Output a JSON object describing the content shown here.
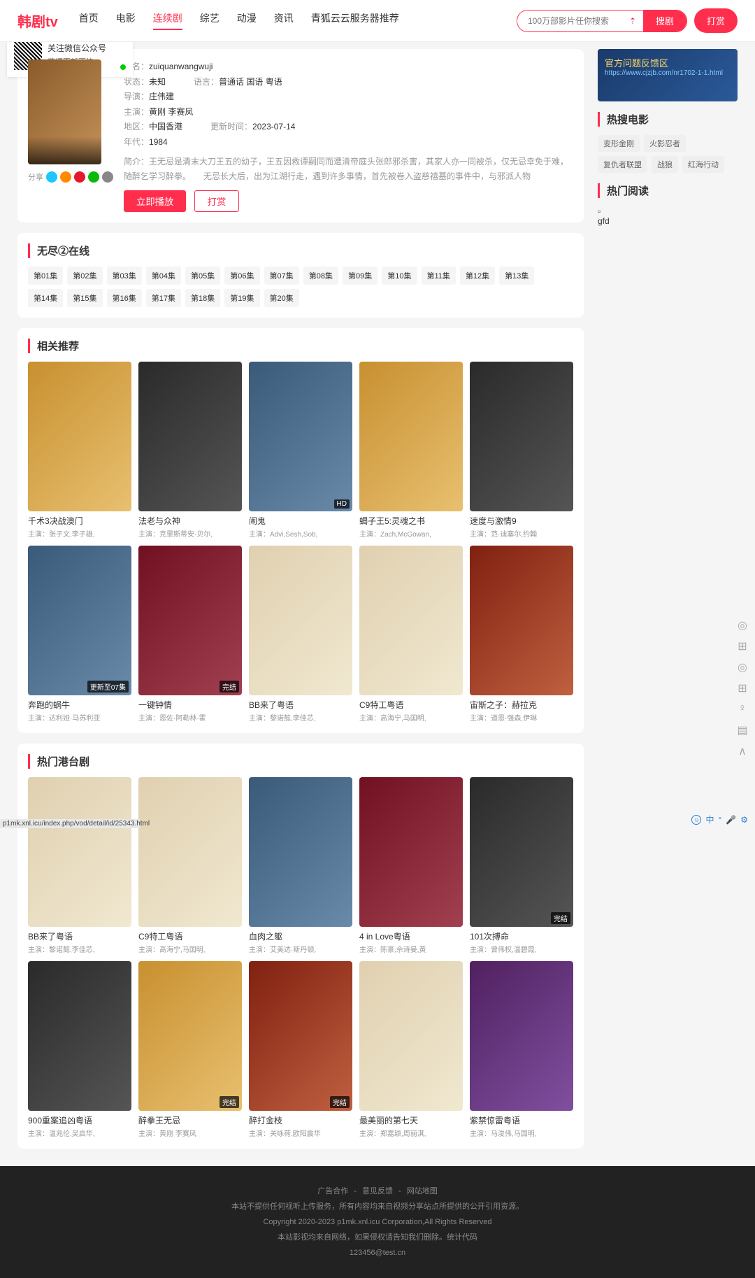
{
  "logo": "韩剧tv",
  "nav": [
    "首页",
    "电影",
    "连续剧",
    "综艺",
    "动漫",
    "资讯",
    "青狐云云服务器推荐"
  ],
  "nav_active": 2,
  "search": {
    "placeholder": "100万部影片任你搜索",
    "btn": "搜剧"
  },
  "reward": "打赏",
  "wechat": {
    "title": "关注微信公众号",
    "sub": "获得更新更快"
  },
  "detail": {
    "alias_lbl": "别名：",
    "alias": "zuiquanwangwuji",
    "status_lbl": "状态：",
    "status": "未知",
    "lang_lbl": "语言：",
    "lang": "普通话 国语 粤语",
    "director_lbl": "导演：",
    "director": "庄伟建",
    "cast_lbl": "主演：",
    "cast": "黄刚 李赛凤",
    "region_lbl": "地区：",
    "region": "中国香港",
    "update_lbl": "更新时间：",
    "update": "2023-07-14",
    "year_lbl": "年代：",
    "year": "1984",
    "intro_lbl": "简介：",
    "intro": "王无忌是清末大刀王五的幼子，王五因救谭嗣同而遭清帝庭头张郎邪杀害，其家人亦一同被杀，仅无忌幸免于难，随醉乞学习醉拳。　　无忌长大后，出为江湖行走，遇到许多事情，首先被卷入盗慈禧墓的事件中，与邪派人物",
    "play": "立即播放",
    "fav": "打赏",
    "share": "分享"
  },
  "eps": {
    "title": "无尽②在线",
    "list": [
      "第01集",
      "第02集",
      "第03集",
      "第04集",
      "第05集",
      "第06集",
      "第07集",
      "第08集",
      "第09集",
      "第10集",
      "第11集",
      "第12集",
      "第13集",
      "第14集",
      "第15集",
      "第16集",
      "第17集",
      "第18集",
      "第19集",
      "第20集"
    ]
  },
  "related": {
    "title": "相关推荐",
    "items": [
      {
        "t": "千术3决战澳门",
        "c": "主演：张子文,李子雄,",
        "p": "pC",
        "b": ""
      },
      {
        "t": "法老与众神",
        "c": "主演：克里斯蒂安·贝尔,",
        "p": "pB",
        "b": ""
      },
      {
        "t": "闹鬼",
        "c": "主演：Advi,Sesh,Sob,",
        "p": "pA",
        "b": "HD"
      },
      {
        "t": "蝎子王5:灵魂之书",
        "c": "主演：Zach,McGowan,",
        "p": "pC",
        "b": ""
      },
      {
        "t": "速度与激情9",
        "c": "主演：范·迪塞尔,约翰",
        "p": "pB",
        "b": ""
      },
      {
        "t": "奔跑的蜗牛",
        "c": "主演：达利娅·马苏利亚",
        "p": "pA",
        "b": "更新至07集"
      },
      {
        "t": "一键钟情",
        "c": "主演：恩佐·阿勒林·霍",
        "p": "pD",
        "b": "完结"
      },
      {
        "t": "BB来了粤语",
        "c": "主演：黎诺懿,李佳芯,",
        "p": "pF",
        "b": ""
      },
      {
        "t": "C9特工粤语",
        "c": "主演：高海宁,马国明,",
        "p": "pF",
        "b": ""
      },
      {
        "t": "宙斯之子：赫拉克",
        "c": "主演：道恩·强森,伊琳",
        "p": "pH",
        "b": ""
      }
    ]
  },
  "hot": {
    "title": "热门港台剧",
    "items": [
      {
        "t": "BB来了粤语",
        "c": "主演：黎诺懿,李佳芯,",
        "p": "pF",
        "b": ""
      },
      {
        "t": "C9特工粤语",
        "c": "主演：高海宁,马国明,",
        "p": "pF",
        "b": ""
      },
      {
        "t": "血肉之躯",
        "c": "主演：艾美达·斯丹顿,",
        "p": "pA",
        "b": ""
      },
      {
        "t": "4 in Love粤语",
        "c": "主演：陈豪,佘诗曼,黄",
        "p": "pD",
        "b": ""
      },
      {
        "t": "101次搏命",
        "c": "主演：曾伟权,温碧霞,",
        "p": "pB",
        "b": "完结"
      },
      {
        "t": "900重案追凶粤语",
        "c": "主演：温兆伦,吴启华,",
        "p": "pB",
        "b": ""
      },
      {
        "t": "醉拳王无忌",
        "c": "主演：黄刚 李赛凤",
        "p": "pC",
        "b": "完结"
      },
      {
        "t": "醉打金枝",
        "c": "主演：关咏荷,欧阳震华",
        "p": "pH",
        "b": "完结"
      },
      {
        "t": "最美丽的第七天",
        "c": "主演：郑嘉颖,周丽淇,",
        "p": "pF",
        "b": ""
      },
      {
        "t": "紫禁惊雷粤语",
        "c": "主演：马浚伟,马国明,",
        "p": "pG",
        "b": ""
      }
    ]
  },
  "side": {
    "banner": {
      "l1": "官方问题反馈区",
      "l2": "https://www.cjzjb.com/nr1702-1-1.html"
    },
    "hot_search": {
      "title": "热搜电影",
      "tags": [
        "变形金刚",
        "火影忍者",
        "复仇者联盟",
        "战狼",
        "红海行动"
      ]
    },
    "hot_read": {
      "title": "热门阅读",
      "item": "gfd"
    }
  },
  "footer": {
    "links": [
      "广告合作",
      "意见反馈",
      "网站地图"
    ],
    "l1": "本站不提供任何视听上传服务，所有内容均来自视频分享站点所提供的公开引用资源。",
    "l2": "Copyright 2020-2023 p1mk.xnl.icu Corporation,All Rights Reserved",
    "l3": "本站影视均来自网络，如果侵权请告知我们删除。统计代码",
    "l4": "123456@test.cn"
  },
  "status_url": "p1mk.xnl.icu/index.php/vod/detail/id/25343.html",
  "ime": [
    "中"
  ]
}
